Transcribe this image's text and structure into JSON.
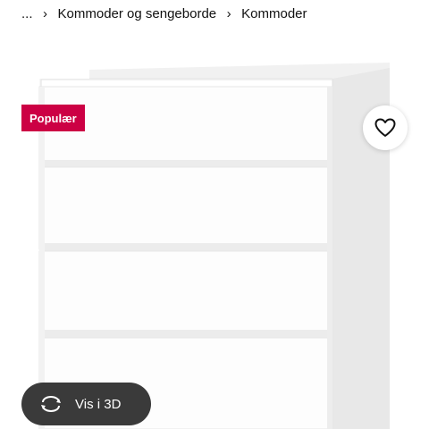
{
  "breadcrumb": {
    "ellipsis": "...",
    "items": [
      "Kommoder og sengeborde",
      "Kommoder"
    ]
  },
  "product": {
    "badge_label": "Populær",
    "view_3d_label": "Vis i 3D"
  },
  "colors": {
    "badge_bg": "#cc0044",
    "view3d_bg": "#3a3a3a"
  },
  "icons": {
    "favorite": "heart-icon",
    "view_3d": "rotate-3d-icon",
    "separator": "chevron-right-icon"
  }
}
